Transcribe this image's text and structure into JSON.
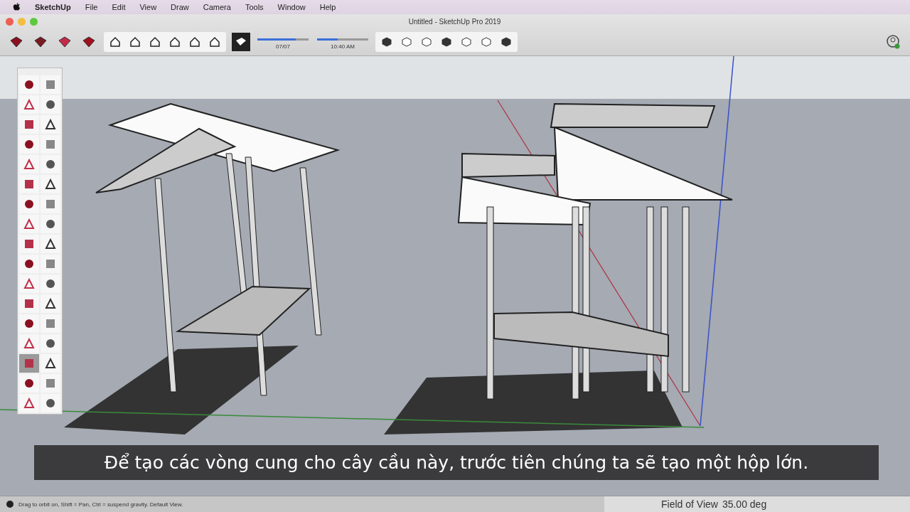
{
  "menu_bar": {
    "app": "SketchUp",
    "items": [
      "File",
      "Edit",
      "View",
      "Draw",
      "Camera",
      "Tools",
      "Window",
      "Help"
    ]
  },
  "window": {
    "title": "Untitled - SketchUp Pro 2019"
  },
  "shadow_controls": [
    {
      "reading": "07/07",
      "level": 0.75
    },
    {
      "reading": "10:40 AM",
      "level": 0.4
    }
  ],
  "tool_palette": {
    "tools": [
      {
        "selected": false
      },
      {
        "selected": false
      },
      {
        "selected": false
      },
      {
        "selected": false
      },
      {
        "selected": false
      },
      {
        "selected": false
      },
      {
        "selected": false
      },
      {
        "selected": false
      },
      {
        "selected": false
      },
      {
        "selected": false
      },
      {
        "selected": false
      },
      {
        "selected": false
      },
      {
        "selected": false
      },
      {
        "selected": false
      },
      {
        "selected": false
      },
      {
        "selected": false
      },
      {
        "selected": false
      },
      {
        "selected": false
      },
      {
        "selected": false
      },
      {
        "selected": false
      },
      {
        "selected": false
      },
      {
        "selected": false
      },
      {
        "selected": false
      },
      {
        "selected": false
      },
      {
        "selected": false
      },
      {
        "selected": false
      },
      {
        "selected": false
      },
      {
        "selected": false
      },
      {
        "selected": true
      },
      {
        "selected": false
      },
      {
        "selected": false
      },
      {
        "selected": false
      },
      {
        "selected": false
      },
      {
        "selected": false
      }
    ]
  },
  "subtitle": "Để tạo các vòng cung cho cây cầu này, trước tiên chúng ta sẽ tạo một hộp lớn.",
  "status_bar": {
    "hint": "Drag to orbit on, Shift = Pan, Ctrl = suspend gravity. Default View.",
    "measurement_label": "Field of View",
    "measurement_value": "35.00 deg"
  }
}
